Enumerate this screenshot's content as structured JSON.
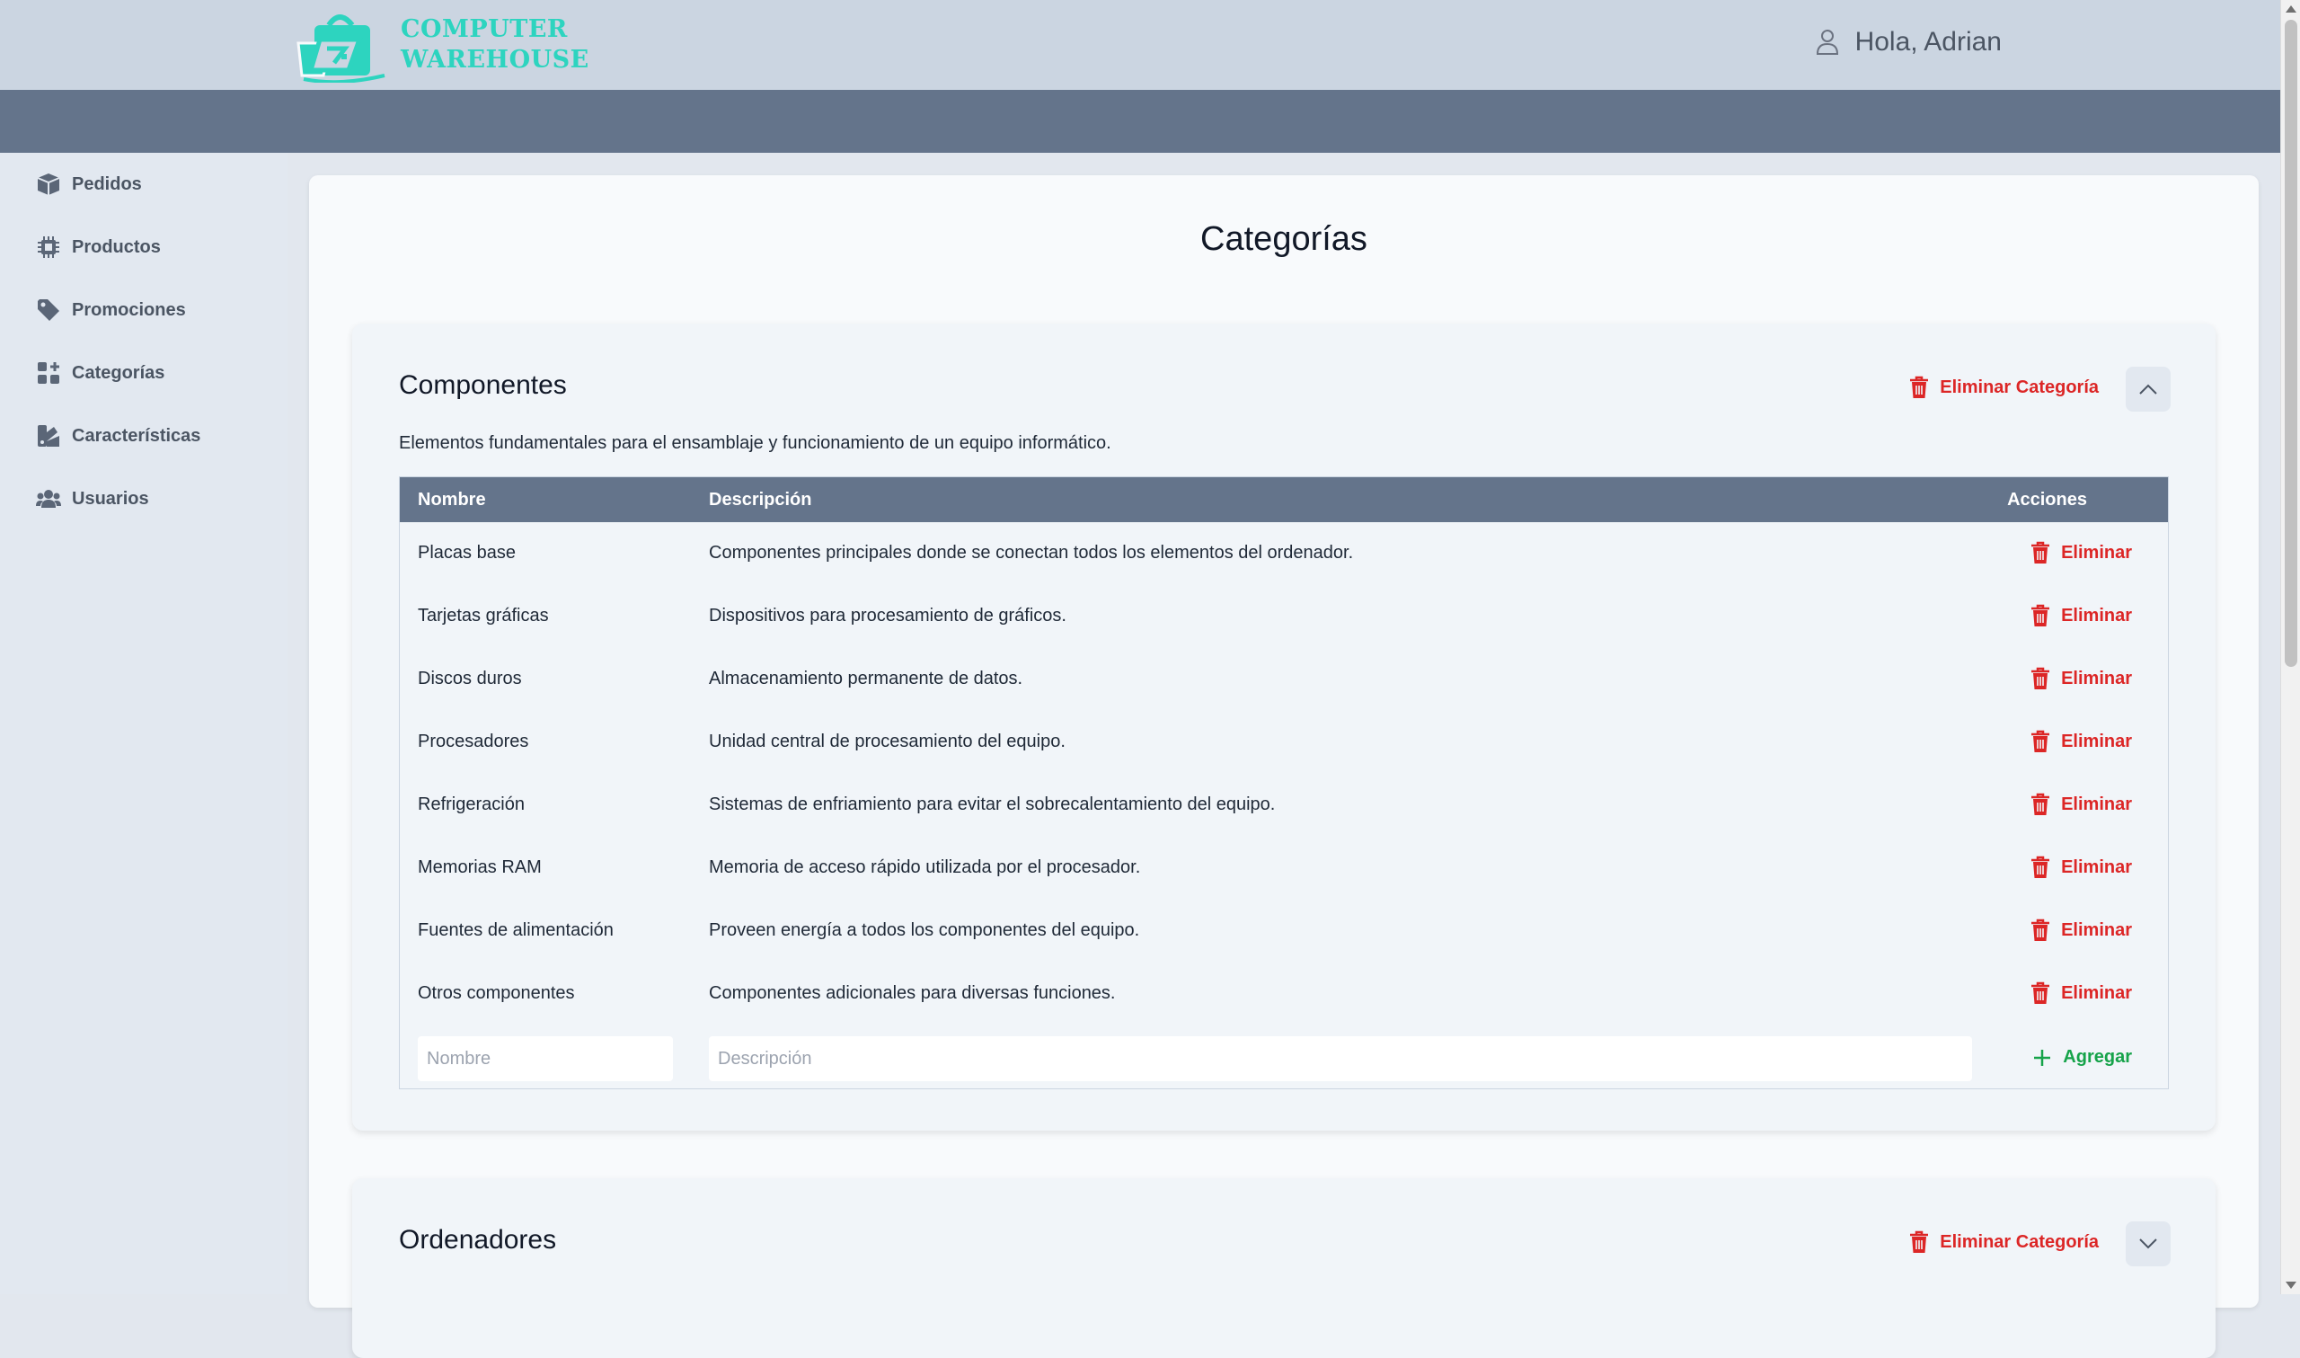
{
  "header": {
    "logo_line1": "COMPUTER",
    "logo_line2": "WAREHOUSE",
    "greeting": "Hola, Adrian",
    "brand_color": "#2dd4bf"
  },
  "sidebar": {
    "items": [
      {
        "label": "Pedidos",
        "icon": "box-icon"
      },
      {
        "label": "Productos",
        "icon": "chip-icon"
      },
      {
        "label": "Promociones",
        "icon": "tag-icon"
      },
      {
        "label": "Categorías",
        "icon": "grid-plus-icon"
      },
      {
        "label": "Características",
        "icon": "swatch-icon"
      },
      {
        "label": "Usuarios",
        "icon": "users-icon"
      }
    ]
  },
  "page": {
    "title": "Categorías"
  },
  "categories": [
    {
      "title": "Componentes",
      "description": "Elementos fundamentales para el ensamblaje y funcionamiento de un equipo informático.",
      "delete_label": "Eliminar Categoría",
      "expanded": true,
      "table": {
        "headers": {
          "name": "Nombre",
          "description": "Descripción",
          "actions": "Acciones"
        },
        "rows": [
          {
            "name": "Placas base",
            "description": "Componentes principales donde se conectan todos los elementos del ordenador.",
            "action": "Eliminar"
          },
          {
            "name": "Tarjetas gráficas",
            "description": "Dispositivos para procesamiento de gráficos.",
            "action": "Eliminar"
          },
          {
            "name": "Discos duros",
            "description": "Almacenamiento permanente de datos.",
            "action": "Eliminar"
          },
          {
            "name": "Procesadores",
            "description": "Unidad central de procesamiento del equipo.",
            "action": "Eliminar"
          },
          {
            "name": "Refrigeración",
            "description": "Sistemas de enfriamiento para evitar el sobrecalentamiento del equipo.",
            "action": "Eliminar"
          },
          {
            "name": "Memorias RAM",
            "description": "Memoria de acceso rápido utilizada por el procesador.",
            "action": "Eliminar"
          },
          {
            "name": "Fuentes de alimentación",
            "description": "Proveen energía a todos los componentes del equipo.",
            "action": "Eliminar"
          },
          {
            "name": "Otros componentes",
            "description": "Componentes adicionales para diversas funciones.",
            "action": "Eliminar"
          }
        ],
        "add_row": {
          "name_placeholder": "Nombre",
          "description_placeholder": "Descripción",
          "add_label": "Agregar"
        }
      }
    },
    {
      "title": "Ordenadores",
      "delete_label": "Eliminar Categoría",
      "expanded": false
    }
  ],
  "colors": {
    "danger": "#dc2626",
    "success": "#16a34a",
    "table_header": "#64748b"
  }
}
